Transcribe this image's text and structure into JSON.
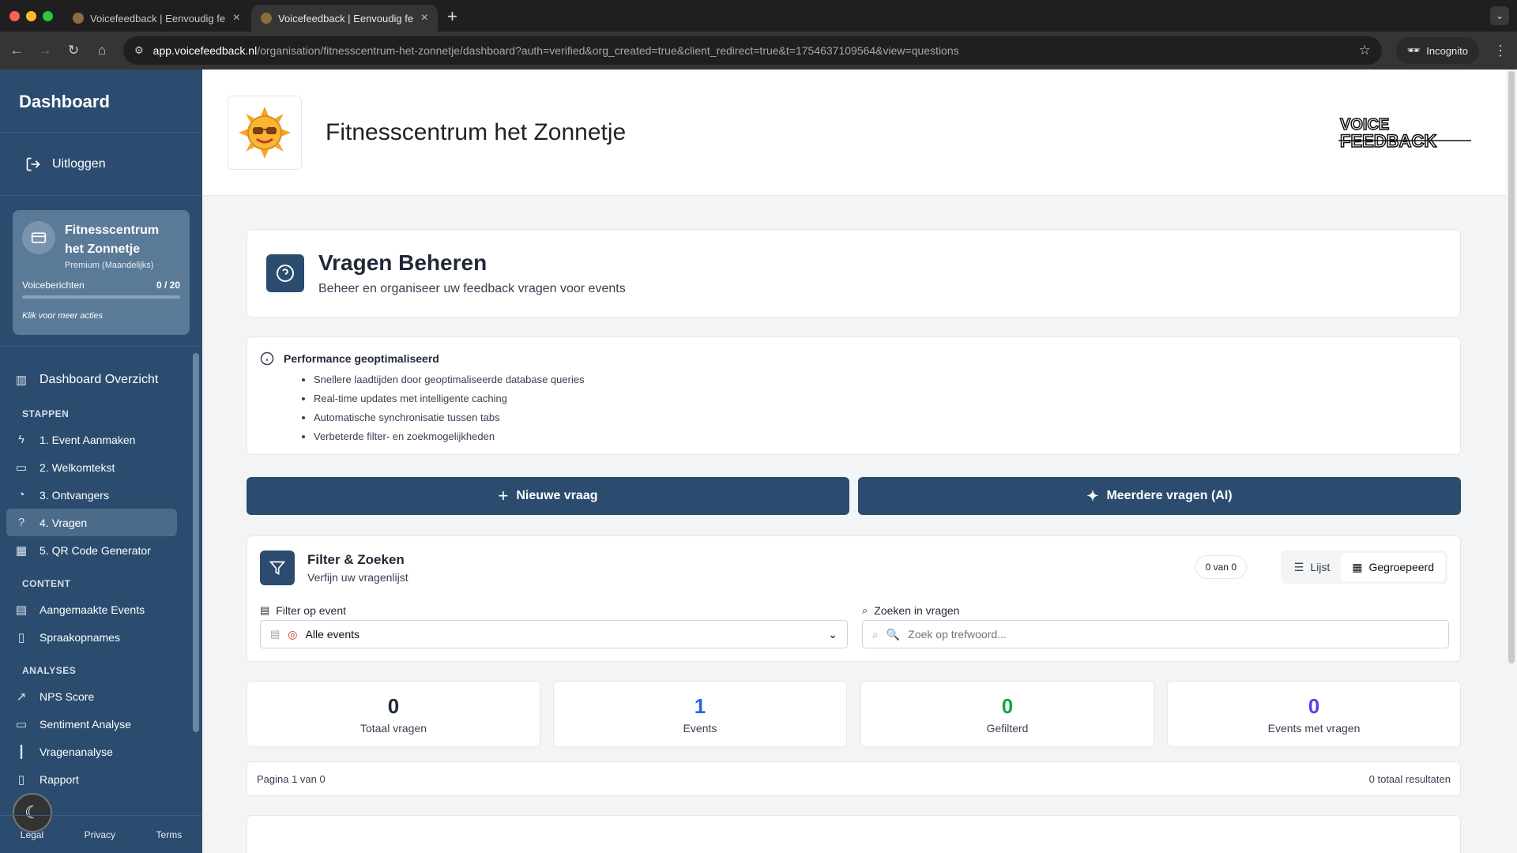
{
  "browser": {
    "tabs": [
      {
        "title": "Voicefeedback | Eenvoudig fe"
      },
      {
        "title": "Voicefeedback | Eenvoudig fe"
      }
    ],
    "url_host": "app.voicefeedback.nl",
    "url_path": "/organisation/fitnesscentrum-het-zonnetje/dashboard?auth=verified&org_created=true&client_redirect=true&t=1754637109564&view=questions",
    "incognito_label": "Incognito"
  },
  "sidebar": {
    "title": "Dashboard",
    "logout": "Uitloggen",
    "org": {
      "name": "Fitnesscentrum het Zonnetje",
      "plan": "Premium (Maandelijks)",
      "quota_label": "Voiceberichten",
      "quota_value": "0 / 20",
      "quota_fraction": 0,
      "more_actions": "Klik voor meer acties"
    },
    "overview": "Dashboard Overzicht",
    "sections": {
      "steps": "STAPPEN",
      "content": "CONTENT",
      "analyses": "ANALYSES"
    },
    "steps": [
      "1. Event Aanmaken",
      "2. Welkomtekst",
      "3. Ontvangers",
      "4. Vragen",
      "5. QR Code Generator"
    ],
    "content": [
      "Aangemaakte Events",
      "Spraakopnames"
    ],
    "analyses": [
      "NPS Score",
      "Sentiment Analyse",
      "Vragenanalyse",
      "Rapport"
    ],
    "footer": [
      "Legal",
      "Privacy",
      "Terms"
    ]
  },
  "header": {
    "org_title": "Fitnesscentrum het Zonnetje",
    "brand_logo_text": [
      "VOICE",
      "FEEDBACK"
    ]
  },
  "page": {
    "title": "Vragen Beheren",
    "subtitle": "Beheer en organiseer uw feedback vragen voor events"
  },
  "performance": {
    "title": "Performance geoptimaliseerd",
    "items": [
      "Snellere laadtijden door geoptimaliseerde database queries",
      "Real-time updates met intelligente caching",
      "Automatische synchronisatie tussen tabs",
      "Verbeterde filter- en zoekmogelijkheden"
    ]
  },
  "actions": {
    "new_question": "Nieuwe vraag",
    "ai_questions": "Meerdere vragen (AI)"
  },
  "filter": {
    "title": "Filter & Zoeken",
    "subtitle": "Verfijn uw vragenlijst",
    "count": "0 van 0",
    "view_list": "Lijst",
    "view_grouped": "Gegroepeerd",
    "event_label": "Filter op event",
    "event_value": "Alle events",
    "search_label": "Zoeken in vragen",
    "search_placeholder": "Zoek op trefwoord..."
  },
  "stats": [
    {
      "value": "0",
      "label": "Totaal vragen",
      "color": "#1f2937"
    },
    {
      "value": "1",
      "label": "Events",
      "color": "#2563eb"
    },
    {
      "value": "0",
      "label": "Gefilterd",
      "color": "#16a34a"
    },
    {
      "value": "0",
      "label": "Events met vragen",
      "color": "#4f46e5"
    }
  ],
  "pager": {
    "page": "Pagina 1 van 0",
    "total": "0 totaal resultaten"
  }
}
